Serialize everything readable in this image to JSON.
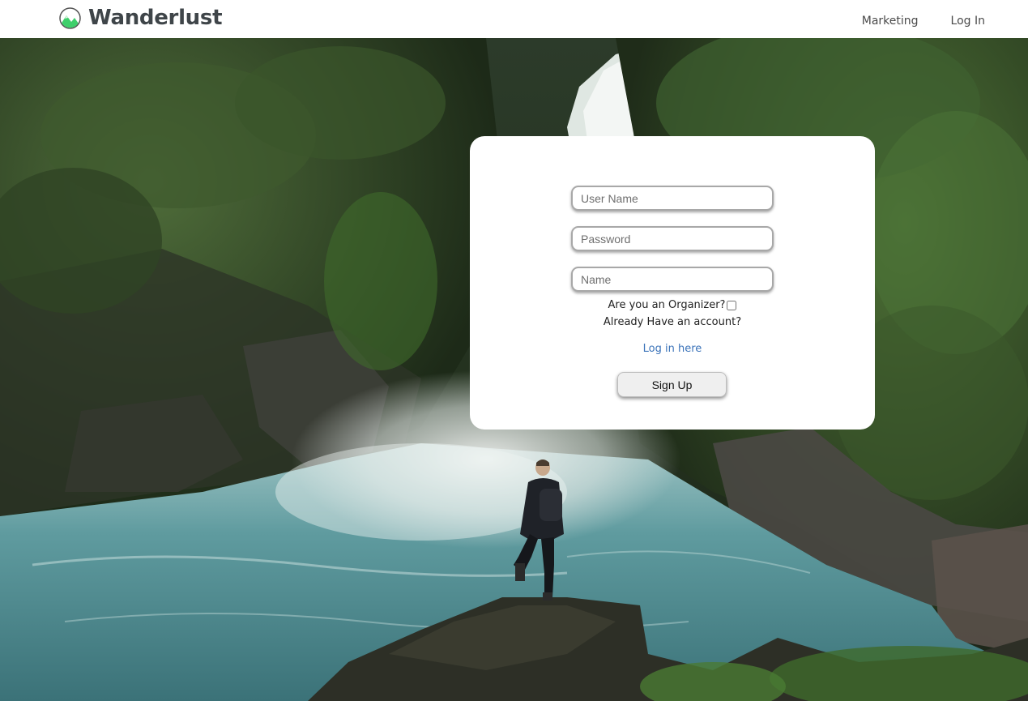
{
  "header": {
    "brand": "Wanderlust",
    "logo_icon": "mountain-logo-icon",
    "nav": [
      {
        "label": "Marketing"
      },
      {
        "label": "Log In"
      }
    ]
  },
  "signup_form": {
    "username_placeholder": "User Name",
    "password_placeholder": "Password",
    "name_placeholder": "Name",
    "organizer_label": "Are you an Organizer?",
    "organizer_checked": false,
    "already_text": "Already Have an account?",
    "login_link": "Log in here",
    "submit_label": "Sign Up"
  },
  "colors": {
    "logo_green": "#3ecf6b",
    "link_blue": "#3b73b9",
    "header_bg": "#ffffff",
    "card_bg": "#ffffff"
  },
  "background": {
    "description_icon": "waterfall-hiker-photo"
  }
}
